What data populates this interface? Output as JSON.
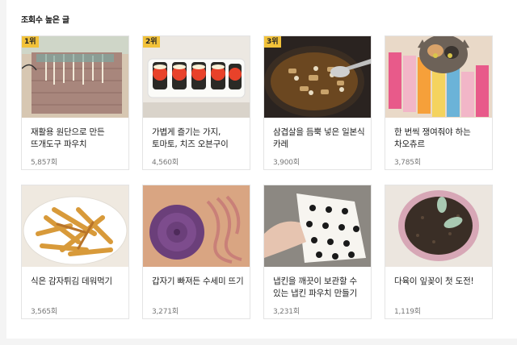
{
  "section_title": "조회수 높은 글",
  "unit_suffix": "회",
  "posts": [
    {
      "rank": "1위",
      "title": "재활용 원단으로 만든 뜨개도구 파우치",
      "views": "5,857회",
      "image": "knitting-tool-pouch"
    },
    {
      "rank": "2위",
      "title": "가볍게 즐기는 가지, 토마토, 치즈 오븐구이",
      "views": "4,560회",
      "image": "eggplant-tomato-bake"
    },
    {
      "rank": "3위",
      "title": "삼겹살을 듬뿍 넣은 일본식 카레",
      "views": "3,900회",
      "image": "japanese-curry"
    },
    {
      "rank": "",
      "title": "한 번씩 쟁여줘야 하는 차오츄르",
      "views": "3,785회",
      "image": "cat-treats"
    },
    {
      "rank": "",
      "title": "식은 감자튀김 데워먹기",
      "views": "3,565회",
      "image": "french-fries"
    },
    {
      "rank": "",
      "title": "갑자기 빠져든 수세미 뜨기",
      "views": "3,271회",
      "image": "crochet-scrubber"
    },
    {
      "rank": "",
      "title": "냅킨을 깨끗이 보관할 수 있는 냅킨 파우치 만들기",
      "views": "3,231회",
      "image": "napkin-pouch"
    },
    {
      "rank": "",
      "title": "다육이 잎꽂이 첫 도전!",
      "views": "1,119회",
      "image": "succulent-pot"
    }
  ]
}
